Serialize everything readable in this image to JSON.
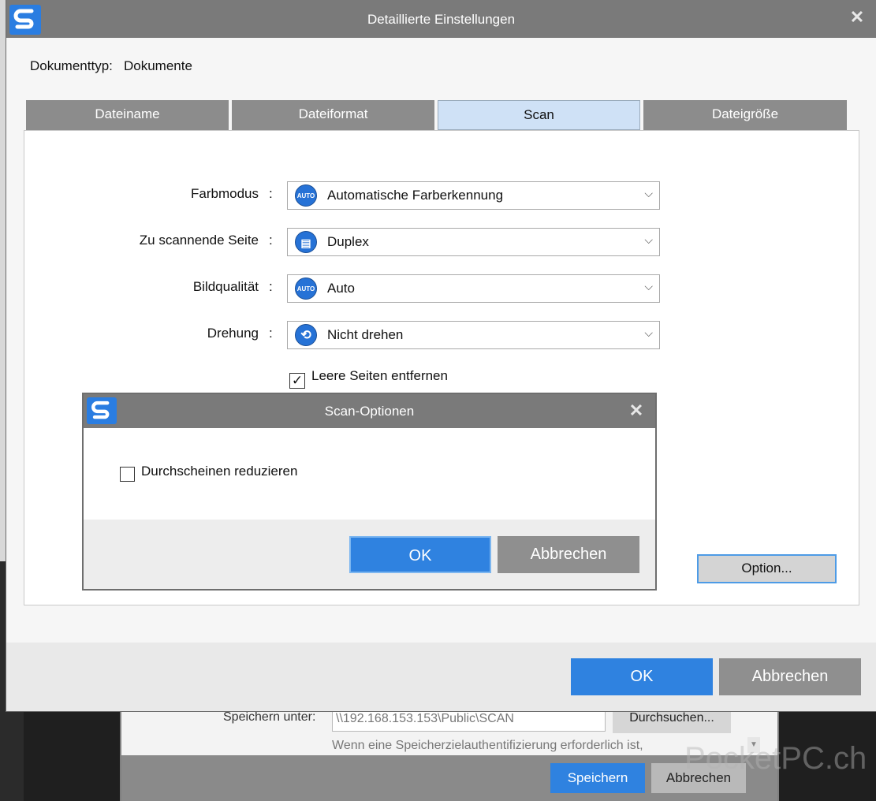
{
  "background_window": {
    "save_location_label": "Speichern unter:",
    "save_location_value": "\\\\192.168.153.153\\Public\\SCAN",
    "browse_label": "Durchsuchen...",
    "auth_hint": "Wenn eine Speicherzielauthentifizierung erforderlich ist,",
    "save_label": "Speichern",
    "cancel_label": "Abbrechen"
  },
  "main_dialog": {
    "title": "Detaillierte Einstellungen",
    "doctype_label": "Dokumenttyp:",
    "doctype_value": "Dokumente",
    "tabs": [
      {
        "label": "Dateiname",
        "active": false
      },
      {
        "label": "Dateiformat",
        "active": false
      },
      {
        "label": "Scan",
        "active": true
      },
      {
        "label": "Dateigröße",
        "active": false
      }
    ],
    "fields": [
      {
        "label": "Farbmodus",
        "value": "Automatische Farberkennung",
        "icon": "auto-color-icon",
        "icon_text": "AUTO"
      },
      {
        "label": "Zu scannende Seite",
        "value": "Duplex",
        "icon": "duplex-page-icon",
        "icon_text": "▤"
      },
      {
        "label": "Bildqualität",
        "value": "Auto",
        "icon": "image-quality-icon",
        "icon_text": "AUTO"
      },
      {
        "label": "Drehung",
        "value": "Nicht drehen",
        "icon": "no-rotation-icon",
        "icon_text": "⟲"
      }
    ],
    "colon": ":",
    "remove_blank_pages": {
      "label": "Leere Seiten entfernen",
      "checked": true
    },
    "option_button": "Option...",
    "ok_label": "OK",
    "cancel_label": "Abbrechen"
  },
  "scan_options_dialog": {
    "title": "Scan-Optionen",
    "reduce_bleed_through": {
      "label": "Durchscheinen reduzieren",
      "checked": false
    },
    "ok_label": "OK",
    "cancel_label": "Abbrechen"
  },
  "watermark": "PocketPC.ch",
  "colors": {
    "accent": "#2f82e0",
    "titlebar": "#7a7a7a",
    "tab_inactive": "#8c8c8c",
    "tab_active": "#cfe1f6"
  }
}
